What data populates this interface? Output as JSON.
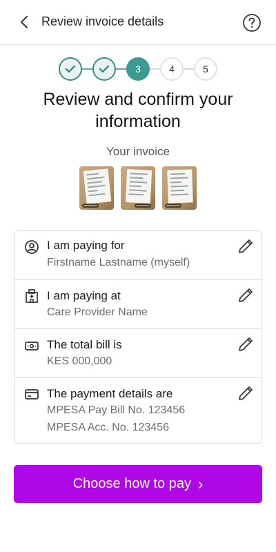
{
  "header": {
    "title": "Review invoice details"
  },
  "stepper": {
    "steps": [
      {
        "label": "",
        "state": "done"
      },
      {
        "label": "",
        "state": "done"
      },
      {
        "label": "3",
        "state": "current"
      },
      {
        "label": "4",
        "state": "todo"
      },
      {
        "label": "5",
        "state": "todo"
      }
    ]
  },
  "main": {
    "title": "Review and confirm your information",
    "invoice_label": "Your invoice",
    "invoice_thumbnails": 3
  },
  "details": [
    {
      "icon": "person-icon",
      "label": "I am paying for",
      "values": [
        "Firstname Lastname (myself)"
      ]
    },
    {
      "icon": "hospital-icon",
      "label": "I am paying at",
      "values": [
        "Care Provider Name"
      ]
    },
    {
      "icon": "cash-icon",
      "label": "The total bill is",
      "values": [
        "KES 000,000"
      ]
    },
    {
      "icon": "credit-card-icon",
      "label": "The payment details are",
      "values": [
        "MPESA Pay Bill No. 123456",
        "MPESA Acc. No. 123456"
      ]
    }
  ],
  "cta": {
    "label": "Choose how to pay",
    "arrow": "›"
  },
  "colors": {
    "accent": "#B007E6",
    "step_teal": "#3B9B93"
  }
}
